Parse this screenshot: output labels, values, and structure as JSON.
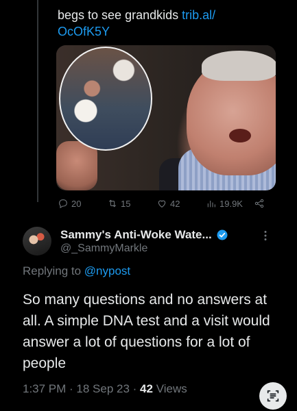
{
  "quoted_tweet": {
    "text": "begs to see grandkids ",
    "link": "trib.al/",
    "link2": "OcOfK5Y"
  },
  "actions": {
    "replies": "20",
    "retweets": "15",
    "likes": "42",
    "views": "19.9K"
  },
  "reply": {
    "name": "Sammy's Anti-Woke Wate...",
    "handle": "@_SammyMarkle",
    "replying_prefix": "Replying to ",
    "replying_to": "@nypost",
    "body": "So many questions and no answers at all. A simple DNA test and a visit would answer a lot of questions for a lot of people",
    "time": "1:37 PM · 18 Sep 23 · ",
    "views_count": "42",
    "views_label": " Views"
  },
  "colors": {
    "accent": "#1d9bf0",
    "muted": "#71767b",
    "text": "#e7e9ea",
    "background": "#000000"
  },
  "icons": [
    "reply-icon",
    "retweet-icon",
    "like-icon",
    "views-icon",
    "share-icon",
    "verified-badge-icon",
    "more-icon",
    "reader-fab-icon"
  ]
}
